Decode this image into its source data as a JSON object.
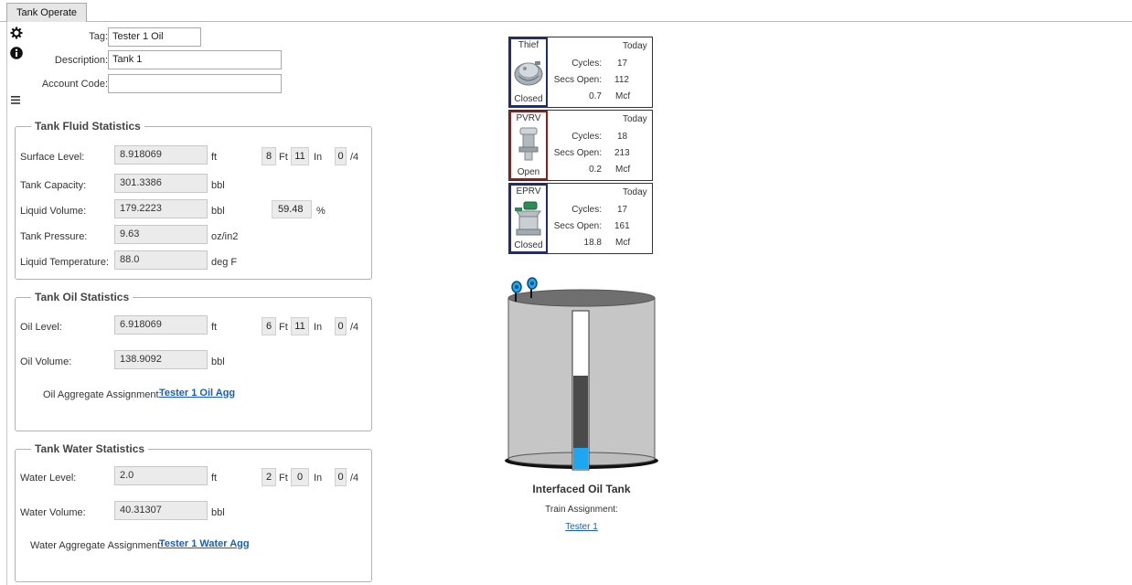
{
  "tab": {
    "label": "Tank Operate"
  },
  "header": {
    "tag_label": "Tag:",
    "tag_value": "Tester 1 Oil",
    "description_label": "Description:",
    "description_value": "Tank 1",
    "account_code_label": "Account Code:",
    "account_code_value": ""
  },
  "icons": {
    "settings": "gear-icon",
    "info": "info-icon",
    "menu": "hamburger-icon"
  },
  "fluid": {
    "title": "Tank Fluid Statistics",
    "surface_level_label": "Surface Level:",
    "surface_level_value": "8.918069",
    "surface_level_unit": "ft",
    "surface_ft": "8",
    "ft_label": "Ft",
    "surface_in": "11",
    "in_label": "In",
    "surface_frac": "0",
    "frac_label": "/4",
    "capacity_label": "Tank Capacity:",
    "capacity_value": "301.3386",
    "capacity_unit": "bbl",
    "liquid_volume_label": "Liquid Volume:",
    "liquid_volume_value": "179.2223",
    "liquid_volume_unit": "bbl",
    "liquid_percent": "59.48",
    "percent_label": "%",
    "pressure_label": "Tank Pressure:",
    "pressure_value": "9.63",
    "pressure_unit": "oz/in2",
    "temp_label": "Liquid Temperature:",
    "temp_value": "88.0",
    "temp_unit": "deg F"
  },
  "oil": {
    "title": "Tank Oil Statistics",
    "level_label": "Oil Level:",
    "level_value": "6.918069",
    "level_unit": "ft",
    "ft": "6",
    "ft_label": "Ft",
    "in": "11",
    "in_label": "In",
    "frac": "0",
    "frac_label": "/4",
    "volume_label": "Oil Volume:",
    "volume_value": "138.9092",
    "volume_unit": "bbl",
    "agg_label": "Oil Aggregate Assignment:",
    "agg_link": "Tester 1 Oil Agg"
  },
  "water": {
    "title": "Tank Water Statistics",
    "level_label": "Water Level:",
    "level_value": "2.0",
    "level_unit": "ft",
    "ft": "2",
    "ft_label": "Ft",
    "in": "0",
    "in_label": "In",
    "frac": "0",
    "frac_label": "/4",
    "volume_label": "Water Volume:",
    "volume_value": "40.31307",
    "volume_unit": "bbl",
    "agg_label": "Water Aggregate Assignment:",
    "agg_link": "Tester 1 Water Agg"
  },
  "valves": [
    {
      "name": "Thief",
      "status": "Closed",
      "period": "Today",
      "cycles_label": "Cycles:",
      "cycles": "17",
      "secs_label": "Secs Open:",
      "secs": "112",
      "volume": "0.7",
      "volume_unit": "Mcf"
    },
    {
      "name": "PVRV",
      "status": "Open",
      "period": "Today",
      "cycles_label": "Cycles:",
      "cycles": "18",
      "secs_label": "Secs Open:",
      "secs": "213",
      "volume": "0.2",
      "volume_unit": "Mcf"
    },
    {
      "name": "EPRV",
      "status": "Closed",
      "period": "Today",
      "cycles_label": "Cycles:",
      "cycles": "17",
      "secs_label": "Secs Open:",
      "secs": "161",
      "volume": "18.8",
      "volume_unit": "Mcf"
    }
  ],
  "tank": {
    "title": "Interfaced Oil Tank",
    "train_label": "Train Assignment:",
    "train_link": "Tester 1",
    "water_fraction": 0.133,
    "oil_fraction": 0.46,
    "colors": {
      "body": "#c8c8c8",
      "water": "#1ea7f0",
      "oil": "#4a4a4a",
      "empty": "#ffffff"
    }
  }
}
